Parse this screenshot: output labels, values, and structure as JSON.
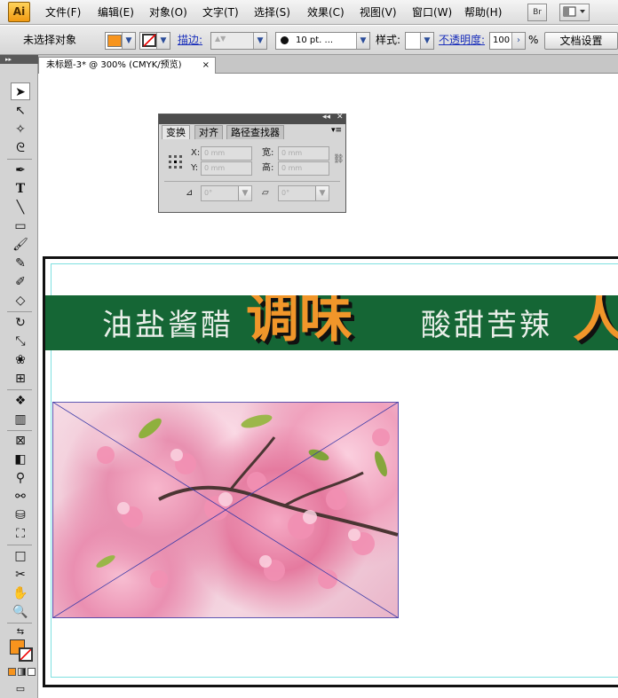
{
  "app": {
    "logo_text": "Ai"
  },
  "menu": {
    "items": [
      "文件(F)",
      "编辑(E)",
      "对象(O)",
      "文字(T)",
      "选择(S)",
      "效果(C)",
      "视图(V)",
      "窗口(W)",
      "帮助(H)"
    ],
    "bridge_label": "Br"
  },
  "control_bar": {
    "selection_status": "未选择对象",
    "fill_color": "#f7941d",
    "stroke_label": "描边:",
    "brush_value": "10 pt. ...",
    "style_label": "样式:",
    "opacity_label": "不透明度:",
    "opacity_value": "100",
    "opacity_unit": "%",
    "doc_setup_button": "文档设置"
  },
  "document_tab": {
    "title": "未标题-3* @ 300% (CMYK/预览)",
    "close_glyph": "×"
  },
  "transform_panel": {
    "tabs": [
      "变换",
      "对齐",
      "路径查找器"
    ],
    "x_label": "X:",
    "y_label": "Y:",
    "w_label": "宽:",
    "h_label": "高:",
    "x_value": "0 mm",
    "y_value": "0 mm",
    "w_value": "0 mm",
    "h_value": "0 mm",
    "rotate_value": "0°",
    "shear_value": "0°"
  },
  "artboard": {
    "banner_color": "#156635",
    "accent_color": "#f1962a",
    "text_1": "油盐酱醋",
    "big_1": "调味",
    "text_2": "酸甜苦辣",
    "big_2": "人"
  },
  "toolbox": {
    "tools": [
      "selection-tool",
      "direct-selection-tool",
      "magic-wand-tool",
      "lasso-tool",
      "pen-tool",
      "type-tool",
      "line-tool",
      "rectangle-tool",
      "paintbrush-tool",
      "pencil-tool",
      "blob-brush-tool",
      "eraser-tool",
      "rotate-tool",
      "scale-tool",
      "warp-tool",
      "free-transform-tool",
      "symbol-sprayer-tool",
      "column-graph-tool",
      "mesh-tool",
      "gradient-tool",
      "eyedropper-tool",
      "blend-tool",
      "live-paint-bucket-tool",
      "live-paint-selection-tool",
      "artboard-tool",
      "slice-tool",
      "hand-tool",
      "zoom-tool"
    ]
  }
}
